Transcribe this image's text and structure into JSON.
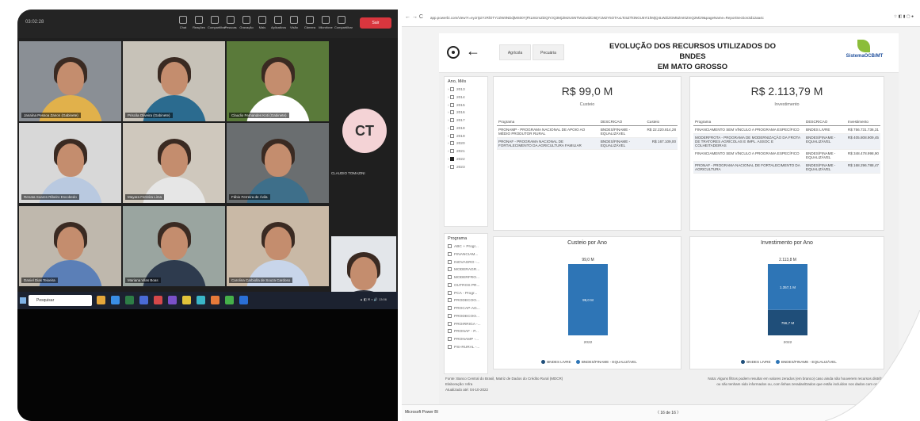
{
  "zoom": {
    "time": "03:02:28",
    "controls": [
      "Chat",
      "Reações",
      "Compartilhar",
      "Pessoas",
      "Gravação",
      "Mais",
      "Aplicativos",
      "Visão",
      "Câmera",
      "Microfone",
      "Compartilhar"
    ],
    "leave_label": "Sair",
    "participants": [
      {
        "name": "Janaína Pessoa Zanon (Gabinete)"
      },
      {
        "name": "Priscila Oliveira (Gabinete)"
      },
      {
        "name": "Claudio Fernandes Koti (Gabinete)"
      },
      {
        "name": "Renata Soares Ribeiro Escobedo"
      },
      {
        "name": "Mayara Ferreira Lima"
      },
      {
        "name": "Fábio Ferreira de Ávila"
      },
      {
        "name": "Daniel Dias Teixeira"
      },
      {
        "name": "Mariana Vilas Boas"
      },
      {
        "name": "Carolina Carbiolla de Souza Cardoso"
      },
      {
        "name": ""
      }
    ],
    "ct_initials": "CT",
    "ct_name": "CLAUDIO TOMAZINI",
    "search_placeholder": "Pesquisar"
  },
  "browser": {
    "url": "app.powerbi.com/view?r=eyJrIjoiYzRlOTYzZWItNDdjMS00YjFkLWJmZDQtYzQ3MjJiMzU5NTM1IiwidCI6IjY1M2Y5OTAxLTc5ZTktNGU5Yi1hMjQ4LWZiZGM5ZmI0ZmQ2MiJ9&pageName=ReportSection3d12aa4c"
  },
  "report": {
    "title_line1": "EVOLUÇÃO DOS RECURSOS UTILIZADOS DO BNDES",
    "title_line2": "EM MATO GROSSO",
    "tabs": [
      "Agrícola",
      "Pecuária"
    ],
    "logo_text": "SistemaOCB/MT",
    "ano_label": "Ano, Mês",
    "anos": [
      "2013",
      "2014",
      "2015",
      "2016",
      "2017",
      "2018",
      "2019",
      "2020",
      "2021",
      "2022",
      "2023"
    ],
    "ano_selected": "2022",
    "programa_label": "Programa",
    "programas": [
      "ABC + Progr...",
      "FINANCIAM...",
      "INOVAGRO -...",
      "MODERAGR...",
      "MODERFRO...",
      "OUTROS PR...",
      "PCA - Progr...",
      "PRODECOO...",
      "PROCAP-AG...",
      "PRODECOO...",
      "PROIRRIGA -...",
      "PRONAF - P...",
      "PRONAMP -...",
      "PSI-RURAL -..."
    ],
    "custeio_value": "R$ 99,0 M",
    "custeio_label": "Custeio",
    "invest_value": "R$ 2.113,79 M",
    "invest_label": "Investimento",
    "custeio_table": {
      "headers": [
        "Programa",
        "DESCRICAO",
        "Custeio"
      ],
      "rows": [
        [
          "PRONAMP - PROGRAMA NACIONAL DE APOIO AO MÉDIO PRODUTOR RURAL",
          "BNDES/FINAME - EQUALIZÁVEL",
          "R$ 22.220.814,28"
        ],
        [
          "PRONAF - PROGRAMA NACIONAL DE FORTALECIMENTO DA AGRICULTURA FAMILIAR",
          "BNDES/FINAME - EQUALIZÁVEL",
          "R$ 167.109,00"
        ]
      ]
    },
    "invest_table": {
      "headers": [
        "Programa",
        "DESCRICAO",
        "Investimento"
      ],
      "rows": [
        [
          "FINANCIAMENTO SEM VÍNCULO A PROGRAMA ESPECÍFICO",
          "BNDES LIVRE",
          "R$ 756.731.736,31"
        ],
        [
          "MODERFROTA - PROGRAMA DE MODERNIZAÇÃO DA FROTA DE TRATORES AGRÍCOLAS E IMPL. ASSOC E COLHEITADEIRAS",
          "BNDES/FINAME - EQUALIZÁVEL",
          "R$ 405.808.909,45"
        ],
        [
          "FINANCIAMENTO SEM VÍNCULO A PROGRAMA ESPECÍFICO",
          "BNDES/FINAME - EQUALIZÁVEL",
          "R$ 348.478.998,90"
        ],
        [
          "PRONAF - PROGRAMA NACIONAL DE FORTALECIMENTO DA AGRICULTURA",
          "BNDES/FINAME - EQUALIZÁVEL",
          "R$ 168.296.788,47"
        ]
      ]
    },
    "legend_items": [
      "BNDES LIVRE",
      "BNDES/FINAME - EQUALIZÁVEL"
    ],
    "footer_left": [
      "Fonte: Banco Central do Brasil, Matriz de Dados do Crédito Rural (MDCR)",
      "Elaboração: Infra",
      "Atualizado até: 04-10-2022"
    ],
    "footer_right": [
      "Nota: Alguns filtros podem resultar em valores zerados (em branco) caso ainda não houverem recursos distribuídos",
      "ou não tenham sido informados ou, com linhas zeradas/Dados que estão incluídos nos dados com os demais."
    ],
    "status_app": "Microsoft Power BI",
    "pager": "〈   16 de 16   〉"
  },
  "colors": {
    "bar_dark": "#1f4e79",
    "bar_mid": "#2e75b6",
    "legend_livre": "#1f4e79",
    "legend_finame": "#2e75b6",
    "zoom_leave": "#d9363e"
  },
  "chart_data": [
    {
      "type": "bar",
      "title": "Custeio por Ano",
      "categories": [
        "2022"
      ],
      "series": [
        {
          "name": "BNDES LIVRE",
          "values": [
            0
          ]
        },
        {
          "name": "BNDES/FINAME - EQUALIZÁVEL",
          "values": [
            99.0
          ]
        }
      ],
      "data_labels": [
        "99,0 M",
        "99,0 M"
      ],
      "total_label": "99,0 M"
    },
    {
      "type": "bar",
      "title": "Investimento por Ano",
      "categories": [
        "2022"
      ],
      "series": [
        {
          "name": "BNDES LIVRE",
          "values": [
            756.7
          ]
        },
        {
          "name": "BNDES/FINAME - EQUALIZÁVEL",
          "values": [
            1357.1
          ]
        }
      ],
      "data_labels": [
        "1.357,1 M",
        "756,7 M"
      ],
      "total_label": "2.113,8 M"
    }
  ]
}
